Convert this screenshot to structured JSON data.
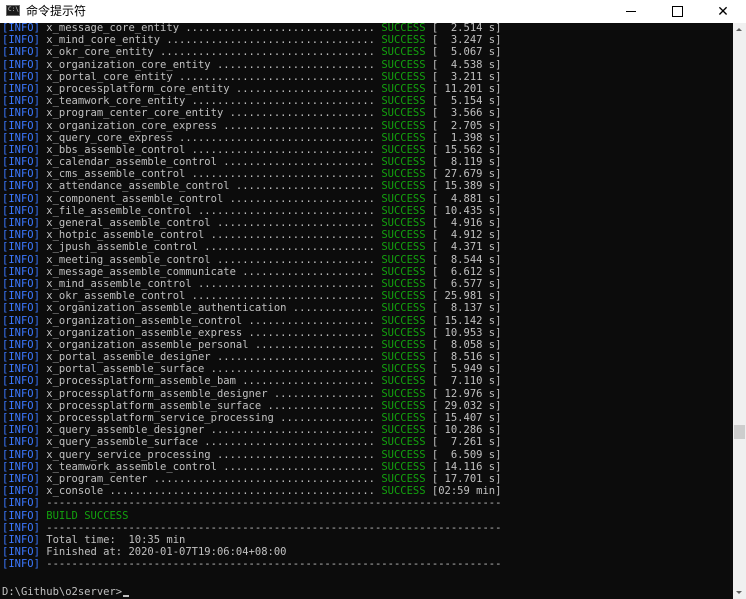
{
  "window": {
    "title": "命令提示符",
    "icon": "cmd-icon",
    "icon_text": "C:\\",
    "controls": {
      "minimize": "minimize-icon",
      "maximize": "maximize-icon",
      "close": "close-icon",
      "close_glyph": "✕"
    }
  },
  "colors": {
    "background": "#0c0c0c",
    "text": "#c0c0c0",
    "info_tag": "#3b78ff",
    "success": "#13a10e"
  },
  "console": {
    "lines": [
      {
        "tag": "[INFO]",
        "text": " x_message_core_entity .............................. ",
        "status": "SUCCESS",
        "tail": " [  2.514 s]"
      },
      {
        "tag": "[INFO]",
        "text": " x_mind_core_entity ................................. ",
        "status": "SUCCESS",
        "tail": " [  3.247 s]"
      },
      {
        "tag": "[INFO]",
        "text": " x_okr_core_entity .................................. ",
        "status": "SUCCESS",
        "tail": " [  5.067 s]"
      },
      {
        "tag": "[INFO]",
        "text": " x_organization_core_entity ......................... ",
        "status": "SUCCESS",
        "tail": " [  4.538 s]"
      },
      {
        "tag": "[INFO]",
        "text": " x_portal_core_entity ............................... ",
        "status": "SUCCESS",
        "tail": " [  3.211 s]"
      },
      {
        "tag": "[INFO]",
        "text": " x_processplatform_core_entity ...................... ",
        "status": "SUCCESS",
        "tail": " [ 11.201 s]"
      },
      {
        "tag": "[INFO]",
        "text": " x_teamwork_core_entity ............................. ",
        "status": "SUCCESS",
        "tail": " [  5.154 s]"
      },
      {
        "tag": "[INFO]",
        "text": " x_program_center_core_entity ....................... ",
        "status": "SUCCESS",
        "tail": " [  3.566 s]"
      },
      {
        "tag": "[INFO]",
        "text": " x_organization_core_express ........................ ",
        "status": "SUCCESS",
        "tail": " [  2.705 s]"
      },
      {
        "tag": "[INFO]",
        "text": " x_query_core_express ............................... ",
        "status": "SUCCESS",
        "tail": " [  1.398 s]"
      },
      {
        "tag": "[INFO]",
        "text": " x_bbs_assemble_control ............................. ",
        "status": "SUCCESS",
        "tail": " [ 15.562 s]"
      },
      {
        "tag": "[INFO]",
        "text": " x_calendar_assemble_control ........................ ",
        "status": "SUCCESS",
        "tail": " [  8.119 s]"
      },
      {
        "tag": "[INFO]",
        "text": " x_cms_assemble_control ............................. ",
        "status": "SUCCESS",
        "tail": " [ 27.679 s]"
      },
      {
        "tag": "[INFO]",
        "text": " x_attendance_assemble_control ...................... ",
        "status": "SUCCESS",
        "tail": " [ 15.389 s]"
      },
      {
        "tag": "[INFO]",
        "text": " x_component_assemble_control ....................... ",
        "status": "SUCCESS",
        "tail": " [  4.881 s]"
      },
      {
        "tag": "[INFO]",
        "text": " x_file_assemble_control ............................ ",
        "status": "SUCCESS",
        "tail": " [ 10.435 s]"
      },
      {
        "tag": "[INFO]",
        "text": " x_general_assemble_control ......................... ",
        "status": "SUCCESS",
        "tail": " [  4.916 s]"
      },
      {
        "tag": "[INFO]",
        "text": " x_hotpic_assemble_control .......................... ",
        "status": "SUCCESS",
        "tail": " [  4.912 s]"
      },
      {
        "tag": "[INFO]",
        "text": " x_jpush_assemble_control ........................... ",
        "status": "SUCCESS",
        "tail": " [  4.371 s]"
      },
      {
        "tag": "[INFO]",
        "text": " x_meeting_assemble_control ......................... ",
        "status": "SUCCESS",
        "tail": " [  8.544 s]"
      },
      {
        "tag": "[INFO]",
        "text": " x_message_assemble_communicate ..................... ",
        "status": "SUCCESS",
        "tail": " [  6.612 s]"
      },
      {
        "tag": "[INFO]",
        "text": " x_mind_assemble_control ............................ ",
        "status": "SUCCESS",
        "tail": " [  6.577 s]"
      },
      {
        "tag": "[INFO]",
        "text": " x_okr_assemble_control ............................. ",
        "status": "SUCCESS",
        "tail": " [ 25.981 s]"
      },
      {
        "tag": "[INFO]",
        "text": " x_organization_assemble_authentication ............. ",
        "status": "SUCCESS",
        "tail": " [  8.137 s]"
      },
      {
        "tag": "[INFO]",
        "text": " x_organization_assemble_control .................... ",
        "status": "SUCCESS",
        "tail": " [ 15.142 s]"
      },
      {
        "tag": "[INFO]",
        "text": " x_organization_assemble_express .................... ",
        "status": "SUCCESS",
        "tail": " [ 10.953 s]"
      },
      {
        "tag": "[INFO]",
        "text": " x_organization_assemble_personal ................... ",
        "status": "SUCCESS",
        "tail": " [  8.058 s]"
      },
      {
        "tag": "[INFO]",
        "text": " x_portal_assemble_designer ......................... ",
        "status": "SUCCESS",
        "tail": " [  8.516 s]"
      },
      {
        "tag": "[INFO]",
        "text": " x_portal_assemble_surface .......................... ",
        "status": "SUCCESS",
        "tail": " [  5.949 s]"
      },
      {
        "tag": "[INFO]",
        "text": " x_processplatform_assemble_bam ..................... ",
        "status": "SUCCESS",
        "tail": " [  7.110 s]"
      },
      {
        "tag": "[INFO]",
        "text": " x_processplatform_assemble_designer ................ ",
        "status": "SUCCESS",
        "tail": " [ 12.976 s]"
      },
      {
        "tag": "[INFO]",
        "text": " x_processplatform_assemble_surface ................. ",
        "status": "SUCCESS",
        "tail": " [ 29.032 s]"
      },
      {
        "tag": "[INFO]",
        "text": " x_processplatform_service_processing ............... ",
        "status": "SUCCESS",
        "tail": " [ 15.407 s]"
      },
      {
        "tag": "[INFO]",
        "text": " x_query_assemble_designer .......................... ",
        "status": "SUCCESS",
        "tail": " [ 10.286 s]"
      },
      {
        "tag": "[INFO]",
        "text": " x_query_assemble_surface ........................... ",
        "status": "SUCCESS",
        "tail": " [  7.261 s]"
      },
      {
        "tag": "[INFO]",
        "text": " x_query_service_processing ......................... ",
        "status": "SUCCESS",
        "tail": " [  6.509 s]"
      },
      {
        "tag": "[INFO]",
        "text": " x_teamwork_assemble_control ........................ ",
        "status": "SUCCESS",
        "tail": " [ 14.116 s]"
      },
      {
        "tag": "[INFO]",
        "text": " x_program_center ................................... ",
        "status": "SUCCESS",
        "tail": " [ 17.701 s]"
      },
      {
        "tag": "[INFO]",
        "text": " x_console .......................................... ",
        "status": "SUCCESS",
        "tail": " [02:59 min]"
      },
      {
        "tag": "[INFO]",
        "text": " ------------------------------------------------------------------------",
        "status": "",
        "tail": ""
      },
      {
        "tag": "[INFO]",
        "text": " ",
        "status": "BUILD SUCCESS",
        "tail": ""
      },
      {
        "tag": "[INFO]",
        "text": " ------------------------------------------------------------------------",
        "status": "",
        "tail": ""
      },
      {
        "tag": "[INFO]",
        "text": " Total time:  10:35 min",
        "status": "",
        "tail": ""
      },
      {
        "tag": "[INFO]",
        "text": " Finished at: 2020-01-07T19:06:04+08:00",
        "status": "",
        "tail": ""
      },
      {
        "tag": "[INFO]",
        "text": " ------------------------------------------------------------------------",
        "status": "",
        "tail": ""
      }
    ],
    "prompt": "D:\\Github\\o2server>"
  }
}
